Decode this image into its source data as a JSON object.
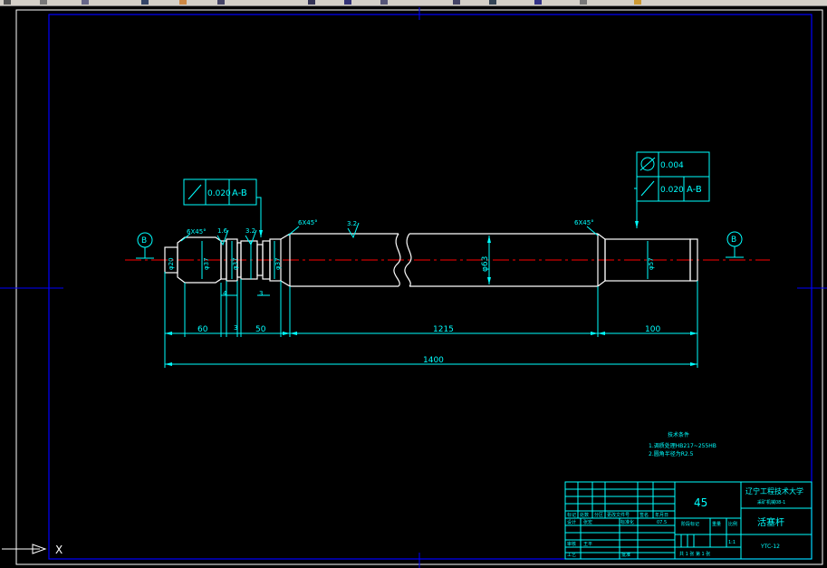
{
  "toolbar": {
    "icons": [
      "undo-icon",
      "redo-icon",
      "pan-icon",
      "zoom-icon",
      "zoom-window-icon",
      "zoom-previous-icon",
      "properties-icon",
      "design-center-icon",
      "tool-palette-icon",
      "layer-icon",
      "color-icon",
      "linetype-icon",
      "lineweight-icon",
      "plot-style-icon"
    ]
  },
  "colors": {
    "background": "#000000",
    "frame": "#0000ff",
    "geometry": "#ffffff",
    "dimension": "#00ffff",
    "centerline": "#ff0000",
    "crosshair": "#0000ff"
  },
  "drawing": {
    "datum_label": "B",
    "tolerance_left": {
      "value": "0.020",
      "datum": "A-B"
    },
    "tolerance_right_top": {
      "value": "0.004"
    },
    "tolerance_right_bottom": {
      "value": "0.020",
      "datum": "A-B"
    },
    "chamfers": [
      "6X45°",
      "6X45°",
      "6X45°"
    ],
    "roughness": [
      "1.6",
      "3.2",
      "3.2"
    ],
    "diameters": {
      "d1": "φ20",
      "d2": "φ37",
      "d3": "φ37",
      "d4": "φ37",
      "d5": "φ63",
      "d6": "φ57"
    },
    "small_dims": [
      "4",
      "3",
      "3"
    ],
    "dimensions": {
      "seg1": "60",
      "seg2": "50",
      "seg3": "1215",
      "seg4": "100",
      "total": "1400"
    }
  },
  "notes": {
    "title": "技术条件",
    "line1": "1.调质处理HB217~255HB",
    "line2": "2.圆角半径为R2.5"
  },
  "title_block": {
    "material": "45",
    "school": "辽宁工程技术大学",
    "class": "采矿机械08-1",
    "part_name": "活塞杆",
    "drawing_no": "YTC-12",
    "scale_value": "1:1",
    "col_headers": [
      "标记",
      "处数",
      "分区",
      "更改文件号",
      "签名",
      "年月日"
    ],
    "design": "设计",
    "designer": "张宏",
    "standardize": "标准化",
    "date": "07.5",
    "stage_mark": "阶段标记",
    "weight": "重量",
    "scale": "比例",
    "review": "审核",
    "reviewer": "王平",
    "process": "工艺",
    "approve": "批准",
    "sheets": "共 1 张 第 1 张"
  },
  "ucs": {
    "x_label": "X"
  }
}
